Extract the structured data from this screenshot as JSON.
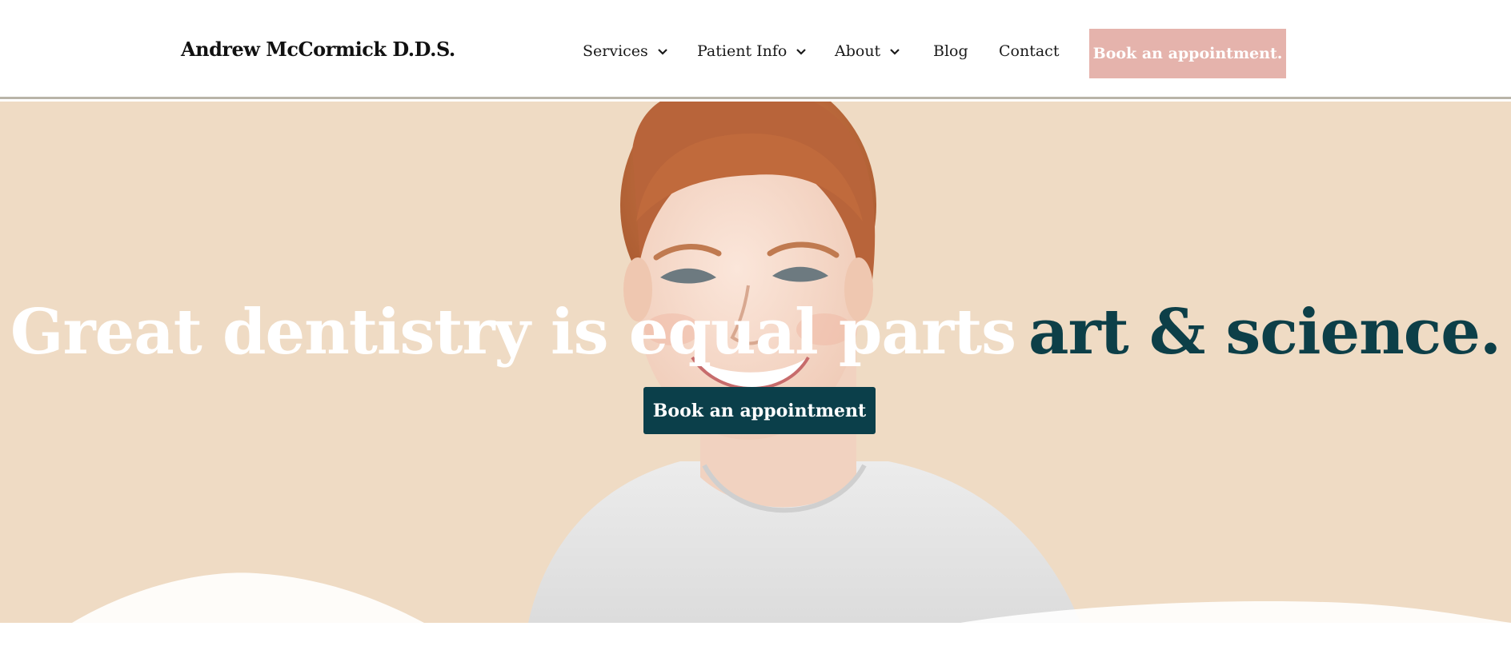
{
  "header": {
    "logo": "Andrew McCormick D.D.S.",
    "nav": [
      {
        "label": "Services",
        "dropdown": true
      },
      {
        "label": "Patient Info",
        "dropdown": true
      },
      {
        "label": "About",
        "dropdown": true
      },
      {
        "label": "Blog",
        "dropdown": false
      },
      {
        "label": "Contact",
        "dropdown": false
      }
    ],
    "cta_label": "Book an appointment."
  },
  "hero": {
    "title_light": "Great dentistry is equal parts",
    "title_dark": "art & science.",
    "button_label": "Book an appointment"
  },
  "colors": {
    "hero_background": "#efdbc4",
    "accent_dark": "#0b3f4a",
    "accent_pink": "#e5b3ac"
  },
  "icons": {
    "nav_dropdown": "chevron-down-icon"
  }
}
